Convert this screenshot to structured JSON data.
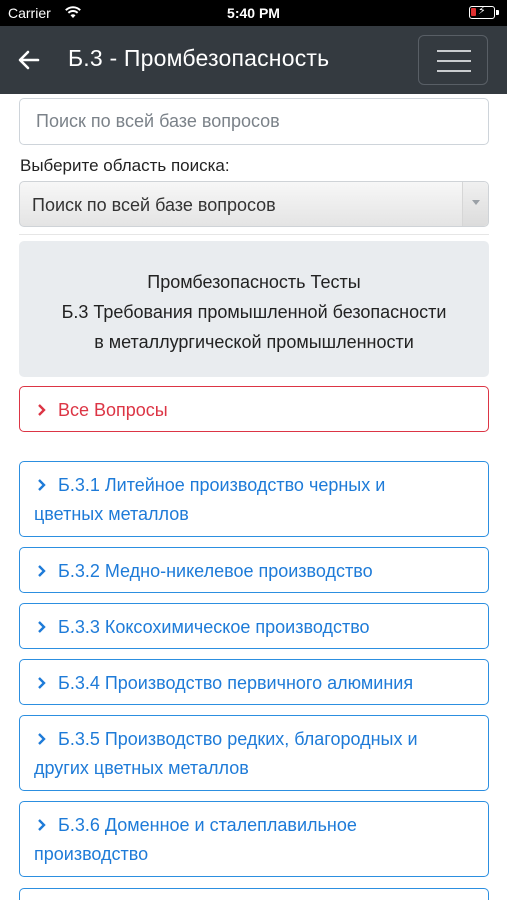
{
  "status_bar": {
    "carrier": "Carrier",
    "time": "5:40 PM"
  },
  "navbar": {
    "title": "Б.3 - Промбезопасность"
  },
  "search": {
    "placeholder": "Поиск по всей базе вопросов"
  },
  "select": {
    "label": "Выберите область поиска:",
    "value": "Поиск по всей базе вопросов"
  },
  "info": {
    "line1": "Промбезопасность Тесты",
    "line2": "Б.3 Требования промышленной безопасности",
    "line3": "в металлургической промышленности"
  },
  "all_questions": "Все Вопросы",
  "sections": [
    {
      "label_line1": "Б.3.1 Литейное производство черных и",
      "label_line2": "цветных металлов"
    },
    {
      "label_line1": "Б.3.2 Медно-никелевое производство",
      "label_line2": ""
    },
    {
      "label_line1": "Б.3.3 Коксохимическое производство",
      "label_line2": ""
    },
    {
      "label_line1": "Б.3.4 Производство первичного алюминия",
      "label_line2": ""
    },
    {
      "label_line1": "Б.3.5 Производство редких, благородных и",
      "label_line2": "других цветных металлов"
    },
    {
      "label_line1": "Б.3.6 Доменное и сталеплавильное",
      "label_line2": "производство"
    }
  ],
  "colors": {
    "navbar": "#343a40",
    "link_blue": "#1e7bd8",
    "danger_red": "#dc3545",
    "info_bg": "#e9ecef"
  }
}
